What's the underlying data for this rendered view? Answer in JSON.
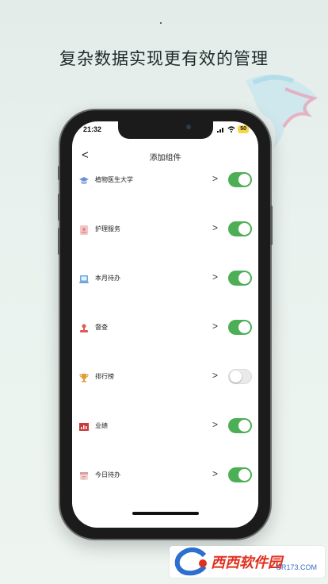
{
  "headline": "复杂数据实现更有效的管理",
  "status": {
    "time": "21:32",
    "battery": "50"
  },
  "nav": {
    "title": "添加组件",
    "back_label": "<"
  },
  "items": [
    {
      "label": "植物医生大学",
      "icon": "graduation-cap-icon",
      "icon_color": "#6f90d8",
      "enabled": true
    },
    {
      "label": "护理服务",
      "icon": "badge-icon",
      "icon_color": "#e48a8a",
      "enabled": true
    },
    {
      "label": "本月待办",
      "icon": "laptop-icon",
      "icon_color": "#6aa6e0",
      "enabled": true
    },
    {
      "label": "督查",
      "icon": "stamp-icon",
      "icon_color": "#e05a5a",
      "enabled": true
    },
    {
      "label": "排行榜",
      "icon": "trophy-icon",
      "icon_color": "#e39a3a",
      "enabled": false
    },
    {
      "label": "业绩",
      "icon": "bar-chart-icon",
      "icon_color": "#c93b3b",
      "enabled": true
    },
    {
      "label": "今日待办",
      "icon": "calendar-icon",
      "icon_color": "#d9a0a0",
      "enabled": true
    }
  ],
  "chevron": ">",
  "watermark": {
    "main": "西西软件园",
    "sub": "CR173.COM"
  },
  "colors": {
    "toggle_on": "#4cae55",
    "toggle_off": "#eaeaea"
  }
}
